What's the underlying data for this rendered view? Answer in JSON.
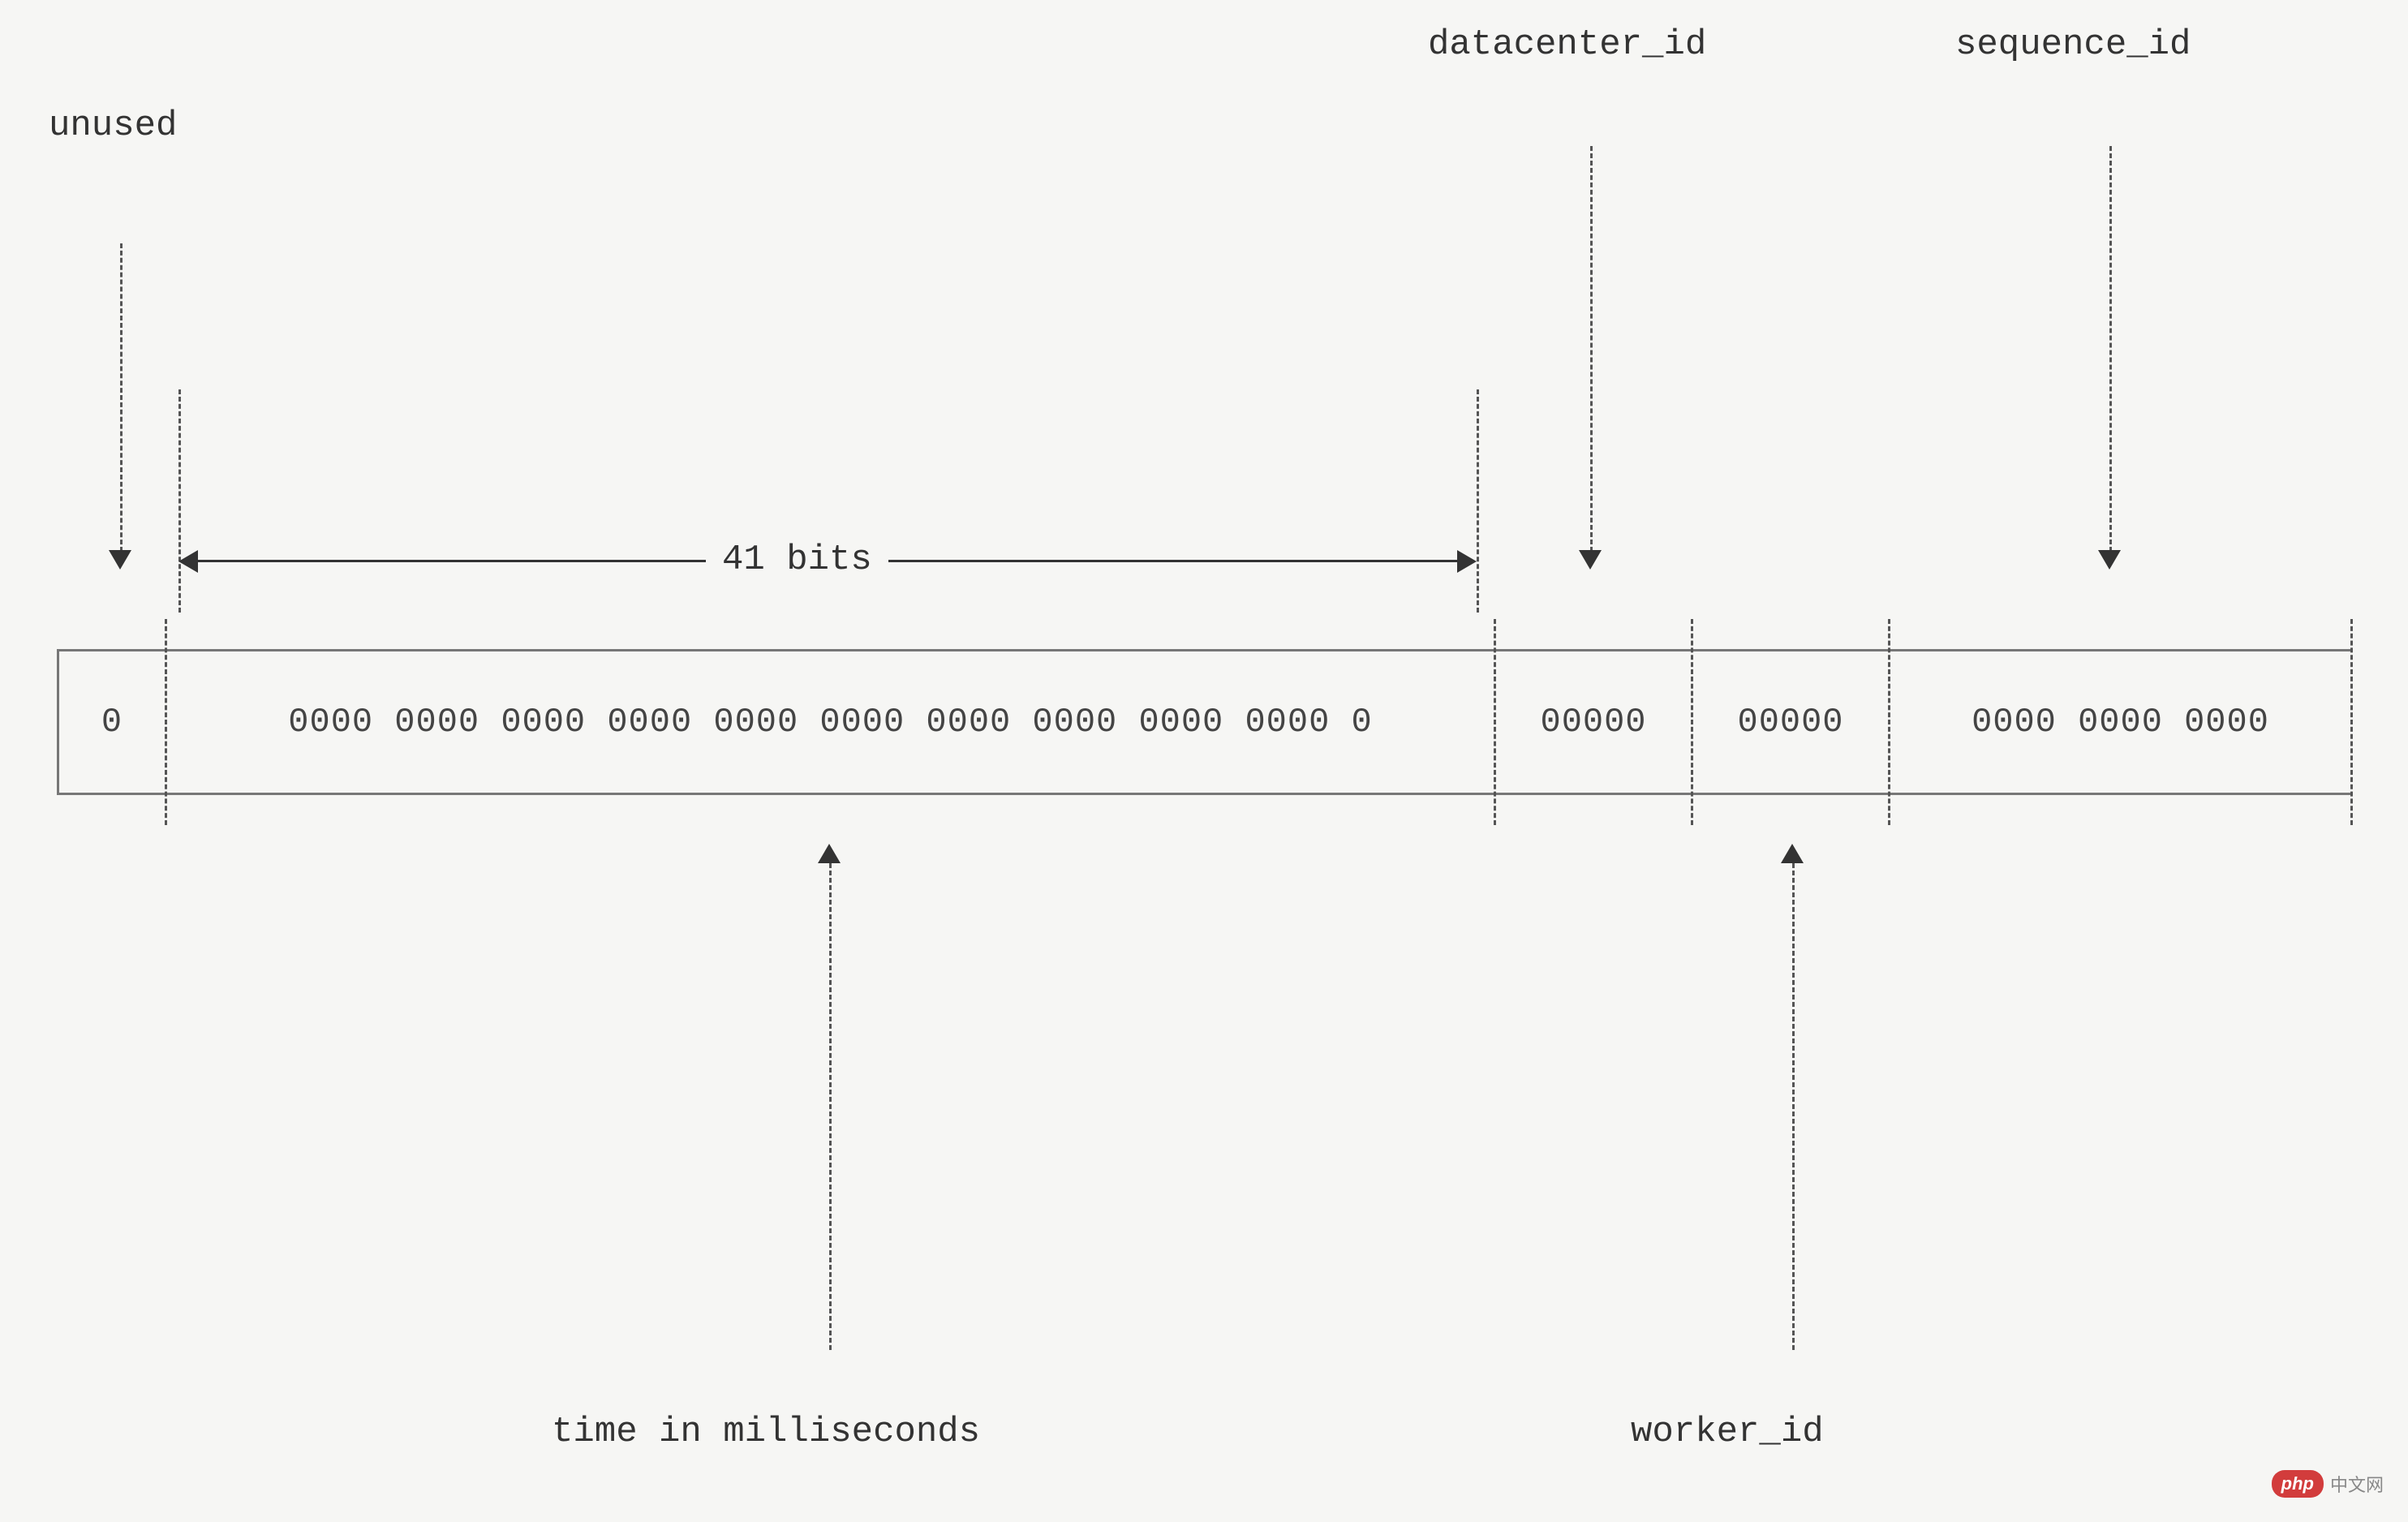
{
  "labels": {
    "unused": "unused",
    "datacenter_id": "datacenter_id",
    "sequence_id": "sequence_id",
    "time_in_ms": "time in milliseconds",
    "worker_id": "worker_id",
    "bits_41": "41 bits"
  },
  "cells": {
    "unused": "0",
    "timestamp": "0000 0000 0000 0000 0000 0000 0000 0000 0000 0000 0",
    "datacenter": "00000",
    "worker": "00000",
    "sequence": "0000 0000 0000"
  },
  "watermark": {
    "badge": "php",
    "text": "中文网"
  },
  "chart_data": {
    "type": "diagram",
    "description": "Snowflake 64-bit ID bit layout",
    "segments": [
      {
        "name": "unused",
        "bits": 1,
        "value": "0"
      },
      {
        "name": "time in milliseconds",
        "bits": 41,
        "value": "0000 0000 0000 0000 0000 0000 0000 0000 0000 0000 0"
      },
      {
        "name": "datacenter_id",
        "bits": 5,
        "value": "00000"
      },
      {
        "name": "worker_id",
        "bits": 5,
        "value": "00000"
      },
      {
        "name": "sequence_id",
        "bits": 12,
        "value": "0000 0000 0000"
      }
    ]
  }
}
